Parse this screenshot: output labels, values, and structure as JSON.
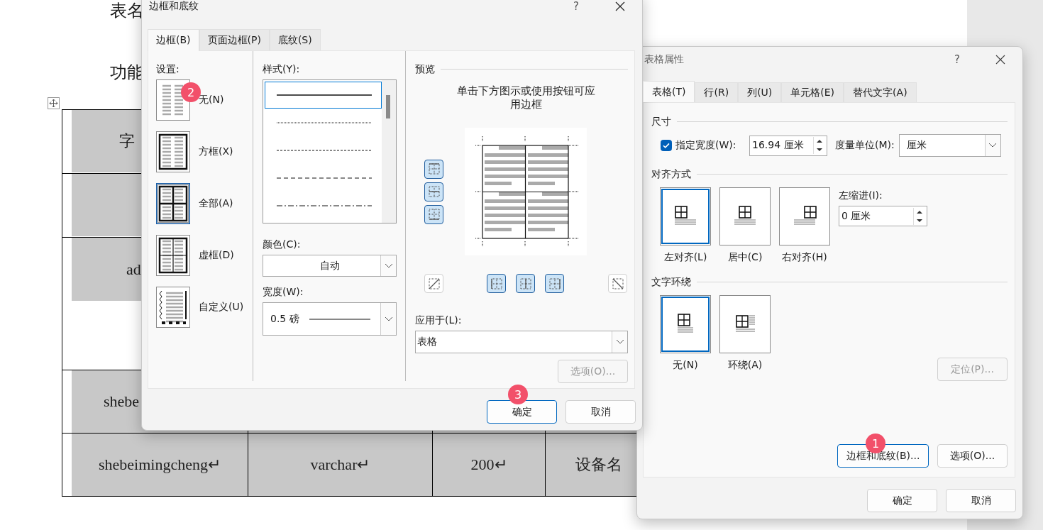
{
  "document": {
    "heading": "表名",
    "label": "功能",
    "table_rows": [
      {
        "kind": "full",
        "cells": [
          "字"
        ]
      },
      {
        "kind": "full"
      },
      {
        "kind": "half",
        "cells": [
          "ad"
        ]
      },
      {
        "kind": "full",
        "cells": [
          "shebe"
        ]
      },
      {
        "kind": "full",
        "cells": [
          "shebeimingcheng↵",
          "varchar↵",
          "200↵",
          "设备名"
        ]
      }
    ]
  },
  "borders_dialog": {
    "title": "边框和底纹",
    "help": "?",
    "tabs": [
      {
        "label": "边框(B)",
        "selected": true
      },
      {
        "label": "页面边框(P)",
        "selected": false
      },
      {
        "label": "底纹(S)",
        "selected": false
      }
    ],
    "setting_label": "设置:",
    "settings": [
      {
        "kind": "none",
        "label": "无(N)",
        "selected": false
      },
      {
        "kind": "box",
        "label": "方框(X)",
        "selected": false
      },
      {
        "kind": "all",
        "label": "全部(A)",
        "selected": true
      },
      {
        "kind": "grid",
        "label": "虚框(D)",
        "selected": false
      },
      {
        "kind": "custom",
        "label": "自定义(U)",
        "selected": false
      }
    ],
    "style_label": "样式(Y):",
    "styles": [
      {
        "kind": "solid",
        "selected": true
      },
      {
        "kind": "dotted",
        "selected": false
      },
      {
        "kind": "fine_dash",
        "selected": false
      },
      {
        "kind": "dash",
        "selected": false
      },
      {
        "kind": "dash_dot",
        "selected": false
      }
    ],
    "color_label": "颜色(C):",
    "color_value": "自动",
    "width_label": "宽度(W):",
    "width_value": "0.5 磅",
    "preview_label": "预览",
    "preview_hint": "单击下方图示或使用按钮可应用边框",
    "side_buttons": [
      {
        "kind": "top",
        "on": true
      },
      {
        "kind": "inside_h",
        "on": true
      },
      {
        "kind": "bottom",
        "on": true
      }
    ],
    "bottom_buttons": [
      {
        "kind": "diag_up",
        "on": false
      },
      {
        "kind": "left",
        "on": true
      },
      {
        "kind": "inside_v",
        "on": true
      },
      {
        "kind": "right",
        "on": true
      },
      {
        "kind": "diag_down",
        "on": false
      }
    ],
    "apply_label": "应用于(L):",
    "apply_value": "表格",
    "options_button": {
      "label": "选项(O)...",
      "disabled": true
    },
    "buttons": [
      "确定",
      "取消"
    ]
  },
  "table_dialog": {
    "title": "表格属性",
    "help": "?",
    "tabs": [
      {
        "label": "表格(T)",
        "selected": true
      },
      {
        "label": "行(R)",
        "selected": false
      },
      {
        "label": "列(U)",
        "selected": false
      },
      {
        "label": "单元格(E)",
        "selected": false
      },
      {
        "label": "替代文字(A)",
        "selected": false
      }
    ],
    "size_label": "尺寸",
    "width_checkbox": {
      "label": "指定宽度(W):",
      "checked": true
    },
    "width_value": "16.94 厘米",
    "unit_label": "度量单位(M):",
    "unit_value": "厘米",
    "align_label": "对齐方式",
    "alignments": [
      {
        "kind": "left",
        "label": "左对齐(L)",
        "selected": true
      },
      {
        "kind": "center",
        "label": "居中(C)",
        "selected": false
      },
      {
        "kind": "right",
        "label": "右对齐(H)",
        "selected": false
      }
    ],
    "indent_label": "左缩进(I):",
    "indent_value": "0 厘米",
    "wrap_label": "文字环绕",
    "wraps": [
      {
        "kind": "none",
        "label": "无(N)",
        "selected": true
      },
      {
        "kind": "around",
        "label": "环绕(A)",
        "selected": false
      }
    ],
    "position_button": {
      "label": "定位(P)...",
      "disabled": true
    },
    "borders_button": "边框和底纹(B)...",
    "options_button": "选项(O)...",
    "buttons": [
      "确定",
      "取消"
    ]
  },
  "badges": [
    "1",
    "2",
    "3"
  ]
}
